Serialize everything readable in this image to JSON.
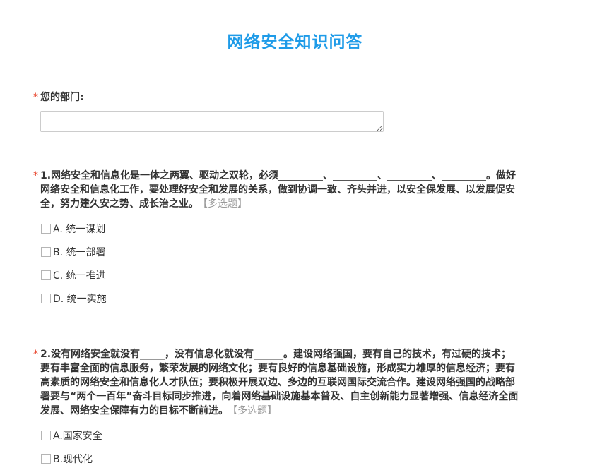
{
  "survey": {
    "title": "网络安全知识问答"
  },
  "questions": [
    {
      "required_mark": "*",
      "text": "您的部门:",
      "type_tag": "",
      "input_value": ""
    },
    {
      "required_mark": "*",
      "text_lines": [
        "1.网络安全和信息化是一体之两翼、驱动之双轮，必须_________、_________、_________、_________。做好",
        "网络安全和信息化工作，要处理好安全和发展的关系，做到协调一致、齐头并进，以安全保发展、以发展促安",
        "全，努力建久安之势、成长治之业。"
      ],
      "type_tag": "【多选题】",
      "options": [
        {
          "label": "A. 统一谋划",
          "checked": false
        },
        {
          "label": "B. 统一部署",
          "checked": false
        },
        {
          "label": "C. 统一推进",
          "checked": false
        },
        {
          "label": "D. 统一实施",
          "checked": false
        }
      ]
    },
    {
      "required_mark": "*",
      "text_lines": [
        "2.没有网络安全就没有_____，没有信息化就没有______。建设网络强国，要有自己的技术，有过硬的技术；",
        "要有丰富全面的信息服务，繁荣发展的网络文化；要有良好的信息基础设施，形成实力雄厚的信息经济；要有",
        "高素质的网络安全和信息化人才队伍；要积极开展双边、多边的互联网国际交流合作。建设网络强国的战略部",
        "署要与“两个一百年”奋斗目标同步推进，向着网络基础设施基本普及、自主创新能力显著增强、信息经济全面",
        "发展、网络安全保障有力的目标不断前进。"
      ],
      "type_tag": "【多选题】",
      "options": [
        {
          "label": "A.国家安全",
          "checked": false
        },
        {
          "label": "B.现代化",
          "checked": false
        }
      ]
    }
  ]
}
